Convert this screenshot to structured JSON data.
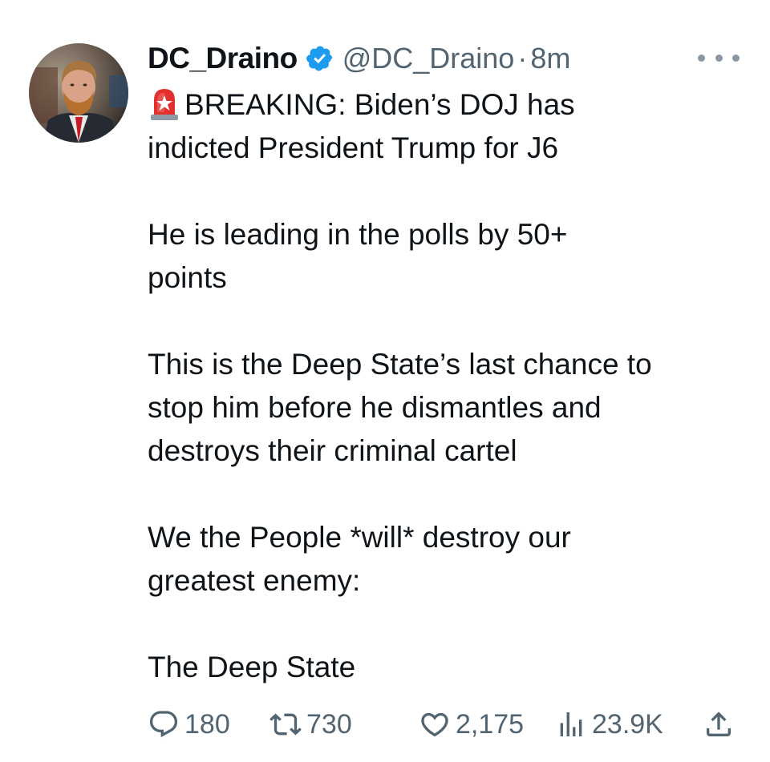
{
  "author": {
    "display_name": "DC_Draino",
    "handle": "@DC_Draino",
    "time_sep": "·",
    "time": "8m",
    "avatar_icon": "avatar-photo",
    "verified_icon": "verified-badge-icon"
  },
  "tweet": {
    "lines": [
      "BREAKING: Biden’s DOJ has",
      "indicted President Trump for J6",
      "He is leading in the polls by 50+",
      "points",
      "This is the Deep State’s last chance to",
      "stop him before he dismantles and",
      "destroys their criminal cartel",
      "We the People *will* destroy our",
      "greatest enemy:",
      "The Deep State"
    ]
  },
  "stats": {
    "replies": "180",
    "retweets": "730",
    "likes": "2,175",
    "views": "23.9K"
  },
  "colors": {
    "text": "#0f1419",
    "secondary": "#536471",
    "verified": "#1d9bf0"
  }
}
